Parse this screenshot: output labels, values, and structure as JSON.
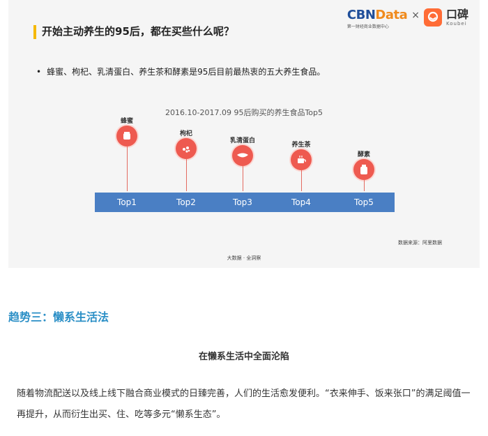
{
  "slide": {
    "title": "开始主动养生的95后，都在买些什么呢？",
    "brand": {
      "cbn": "CBN",
      "data": "Data",
      "tagline": "第一财经商业数据中心",
      "separator": "×",
      "koubei_cn": "口碑",
      "koubei_en": "Koubei"
    },
    "bullet": "蜂蜜、枸杞、乳清蛋白、养生茶和酵素是95后目前最热衷的五大养生食品。",
    "source": "数据来源：阿里数据",
    "footer": "大数据 · 全洞察"
  },
  "chart_data": {
    "type": "table",
    "title": "2016.10-2017.09 95后购买的养生食品Top5",
    "categories": [
      "Top1",
      "Top2",
      "Top3",
      "Top4",
      "Top5"
    ],
    "items": [
      "蜂蜜",
      "枸杞",
      "乳清蛋白",
      "养生茶",
      "酵素"
    ]
  },
  "article": {
    "section_heading": "趋势三：懒系生活法",
    "subheading": "在懒系生活中全面沦陷",
    "paragraph": "随着物流配送以及线上线下融合商业模式的日臻完善，人们的生活愈发便利。“衣来伸手、饭来张口”的满足阈值一再提升，从而衍生出买、住、吃等多元“懒系生态”。"
  }
}
